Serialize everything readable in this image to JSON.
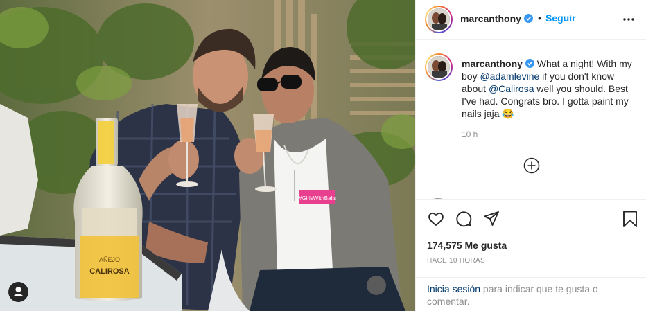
{
  "post": {
    "photo": {
      "bottle_label": "CALIROSA",
      "bottle_sublabel": "AÑEJO",
      "shirt_text": "#GirlsWithBalls"
    },
    "author": {
      "username": "marcanthony",
      "verified": true,
      "follow_label": "Seguir",
      "separator": "•"
    },
    "caption": {
      "username": "marcanthony",
      "text_1": " What a night! With my boy ",
      "mention_1": "@adamlevine",
      "text_2": " if you don't know about ",
      "mention_2": "@Calirosa",
      "text_3": " well you should. Best I've had. Congrats bro. I gotta paint my nails jaja 😂",
      "time": "10 h"
    },
    "likes": "174,575 Me gusta",
    "posted_ago": "HACE 10 HORAS",
    "login_prompt": {
      "link": "Inicia sesión",
      "rest": " para indicar que te gusta o comentar."
    },
    "icons": {
      "verified": "verified-badge-icon",
      "more": "more-options-icon",
      "load_more": "plus-circle-icon",
      "like": "heart-icon",
      "comment": "comment-icon",
      "share": "send-icon",
      "save": "bookmark-icon",
      "tag": "user-tag-icon"
    },
    "colors": {
      "accent": "#0095f6",
      "mention": "#00376b",
      "muted": "#8e8e8e",
      "text": "#262626"
    }
  }
}
